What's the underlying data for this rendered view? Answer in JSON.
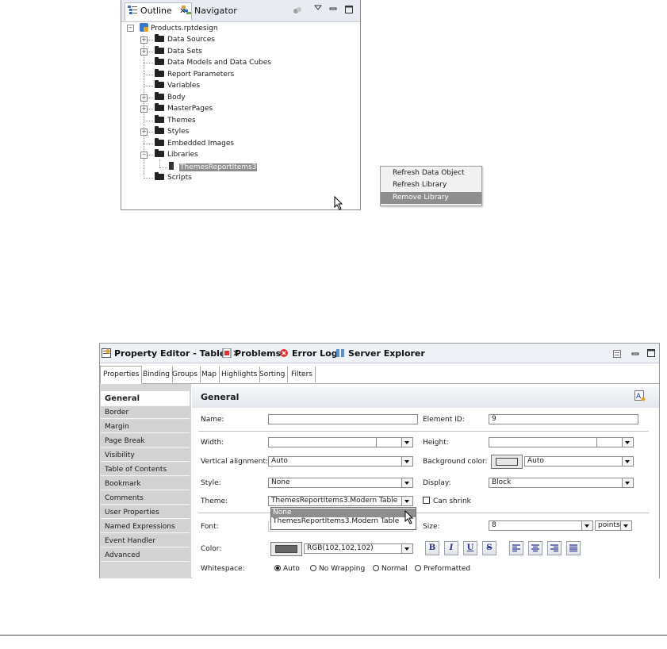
{
  "outline": {
    "tab_outline": "Outline",
    "tab_navigator": "Navigator",
    "root": "Products.rptdesign",
    "nodes": [
      {
        "label": "Data Sources",
        "expandable": true
      },
      {
        "label": "Data Sets",
        "expandable": true
      },
      {
        "label": "Data Models and Data Cubes",
        "expandable": false
      },
      {
        "label": "Report Parameters",
        "expandable": false
      },
      {
        "label": "Variables",
        "expandable": false
      },
      {
        "label": "Body",
        "expandable": true
      },
      {
        "label": "MasterPages",
        "expandable": true
      },
      {
        "label": "Themes",
        "expandable": false
      },
      {
        "label": "Styles",
        "expandable": true
      },
      {
        "label": "Embedded Images",
        "expandable": false
      },
      {
        "label": "Libraries",
        "expandable": true,
        "expanded": true
      },
      {
        "label": "Scripts",
        "expandable": false
      }
    ],
    "library_child": "ThemesReportItems3",
    "context_menu": [
      "Refresh Data Object",
      "Refresh Library",
      "Remove Library"
    ],
    "context_selected": "Remove Library"
  },
  "property_editor": {
    "view_tabs": [
      "Property Editor - Table",
      "Problems",
      "Error Log",
      "Server Explorer"
    ],
    "prop_tabs": [
      "Properties",
      "Binding",
      "Groups",
      "Map",
      "Highlights",
      "Sorting",
      "Filters"
    ],
    "categories": [
      "General",
      "Border",
      "Margin",
      "Page Break",
      "Visibility",
      "Table of Contents",
      "Bookmark",
      "Comments",
      "User Properties",
      "Named Expressions",
      "Event Handler",
      "Advanced"
    ],
    "section_title": "General",
    "fields": {
      "name_label": "Name:",
      "name_value": "",
      "element_id_label": "Element ID:",
      "element_id_value": "9",
      "width_label": "Width:",
      "height_label": "Height:",
      "valign_label": "Vertical alignment:",
      "valign_value": "Auto",
      "bgcolor_label": "Background color:",
      "bgcolor_value": "Auto",
      "style_label": "Style:",
      "style_value": "None",
      "display_label": "Display:",
      "display_value": "Block",
      "theme_label": "Theme:",
      "theme_value": "ThemesReportItems3.Modern Table",
      "can_shrink_label": "Can shrink",
      "font_label": "Font:",
      "size_label": "Size:",
      "size_value": "8",
      "size_unit": "points",
      "color_label": "Color:",
      "color_value": "RGB(102,102,102)",
      "whitespace_label": "Whitespace:",
      "whitespace_options": [
        "Auto",
        "No Wrapping",
        "Normal",
        "Preformatted"
      ],
      "whitespace_selected": "Auto"
    },
    "theme_options": [
      "None",
      "ThemesReportItems3.Modern Table"
    ],
    "format_buttons": [
      "B",
      "I",
      "U",
      "S"
    ]
  },
  "colors": {
    "selection_gray": "#8e8e8e",
    "tab_bar": "#e8ecf2",
    "category_bg": "#d2d2d2",
    "text_color_swatch": "#666666"
  }
}
